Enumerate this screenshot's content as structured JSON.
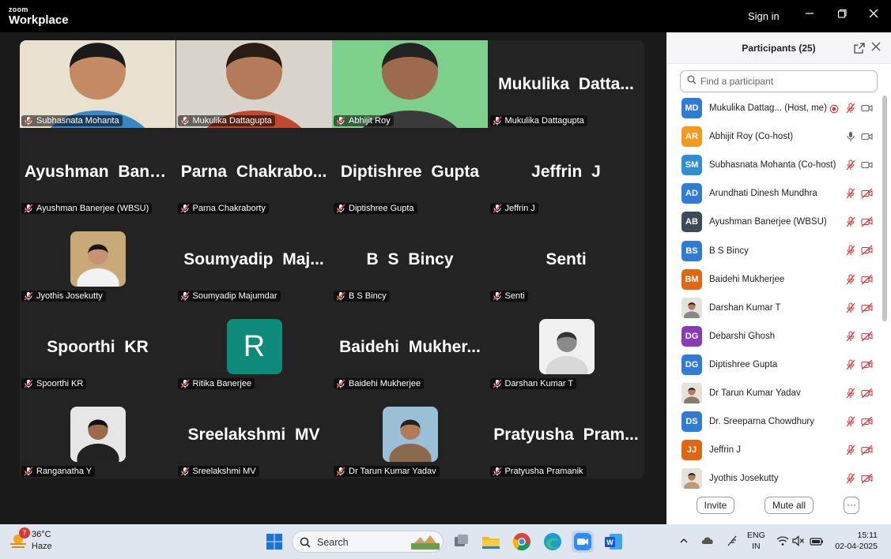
{
  "window": {
    "brand_top": "zoom",
    "brand_main": "Workplace",
    "sign_in": "Sign in",
    "controls": [
      "minimize-icon",
      "maximize-icon",
      "close-icon"
    ]
  },
  "gallery": {
    "tiles": [
      {
        "label": "Subhasnata Mohanta",
        "kind": "video"
      },
      {
        "label": "Mukulika Dattagupta",
        "kind": "video"
      },
      {
        "label": "Abhijit Roy",
        "kind": "video",
        "active": true
      },
      {
        "label": "Mukulika Dattagupta",
        "display": "Mukulika Datta...",
        "kind": "name"
      },
      {
        "label": "Ayushman Banerjee (WBSU)",
        "display": "Ayushman Bane...",
        "kind": "name"
      },
      {
        "label": "Parna Chakraborty",
        "display": "Parna Chakrabo...",
        "kind": "name"
      },
      {
        "label": "Diptishree Gupta",
        "display": "Diptishree Gupta",
        "kind": "name"
      },
      {
        "label": "Jeffrin J",
        "display": "Jeffrin J",
        "kind": "name"
      },
      {
        "label": "Jyothis Josekutty",
        "kind": "photo"
      },
      {
        "label": "Soumyadip Majumdar",
        "display": "Soumyadip Maj...",
        "kind": "name"
      },
      {
        "label": "B S Bincy",
        "display": "B S Bincy",
        "kind": "name"
      },
      {
        "label": "Senti",
        "display": "Senti",
        "kind": "name"
      },
      {
        "label": "Spoorthi KR",
        "display": "Spoorthi KR",
        "kind": "name"
      },
      {
        "label": "Ritika Banerjee",
        "display": "R",
        "kind": "letter"
      },
      {
        "label": "Baidehi Mukherjee",
        "display": "Baidehi Mukher...",
        "kind": "name"
      },
      {
        "label": "Darshan Kumar T",
        "kind": "photo"
      },
      {
        "label": "Ranganatha Y",
        "kind": "photo"
      },
      {
        "label": "Sreelakshmi MV",
        "display": "Sreelakshmi MV",
        "kind": "name"
      },
      {
        "label": "Dr Tarun Kumar Yadav",
        "kind": "photo"
      },
      {
        "label": "Pratyusha Pramanik",
        "display": "Pratyusha Pram...",
        "kind": "name"
      }
    ]
  },
  "participants": {
    "title": "Participants (25)",
    "search_placeholder": "Find a participant",
    "list": [
      {
        "initials": "MD",
        "name": "Mukulika Dattag...  (Host, me)",
        "color": "#2f7bd6",
        "mic": "muted",
        "cam": "on",
        "rec": true
      },
      {
        "initials": "AR",
        "name": "Abhijit Roy (Co-host)",
        "color": "#f39a1e",
        "mic": "on",
        "cam": "on"
      },
      {
        "initials": "SM",
        "name": "Subhasnata Mohanta (Co-host)",
        "color": "#2f8fcf",
        "mic": "muted",
        "cam": "on"
      },
      {
        "initials": "AD",
        "name": "Arundhati Dinesh Mundhra",
        "color": "#2f7bd6",
        "mic": "muted",
        "cam": "off"
      },
      {
        "initials": "AB",
        "name": "Ayushman Banerjee (WBSU)",
        "color": "#3d4a5c",
        "mic": "muted",
        "cam": "off"
      },
      {
        "initials": "BS",
        "name": "B S Bincy",
        "color": "#2f7bd6",
        "mic": "muted",
        "cam": "off"
      },
      {
        "initials": "BM",
        "name": "Baidehi Mukherjee",
        "color": "#e0670f",
        "mic": "muted",
        "cam": "off"
      },
      {
        "initials": "",
        "name": "Darshan Kumar T",
        "color": "#888888",
        "mic": "muted",
        "cam": "off",
        "photo": true
      },
      {
        "initials": "DG",
        "name": "Debarshi Ghosh",
        "color": "#8a3ab9",
        "mic": "muted",
        "cam": "off"
      },
      {
        "initials": "DG",
        "name": "Diptishree Gupta",
        "color": "#2f7bd6",
        "mic": "muted",
        "cam": "off"
      },
      {
        "initials": "",
        "name": "Dr Tarun Kumar Yadav",
        "color": "#8a7a6a",
        "mic": "muted",
        "cam": "off",
        "photo": true
      },
      {
        "initials": "DS",
        "name": "Dr. Sreeparna Chowdhury",
        "color": "#2f7bd6",
        "mic": "muted",
        "cam": "off"
      },
      {
        "initials": "JJ",
        "name": "Jeffrin J",
        "color": "#e0670f",
        "mic": "muted",
        "cam": "off"
      },
      {
        "initials": "",
        "name": "Jyothis Josekutty",
        "color": "#b79b7a",
        "mic": "muted",
        "cam": "off",
        "photo": true
      }
    ],
    "invite": "Invite",
    "mute_all": "Mute all",
    "more": "···"
  },
  "taskbar": {
    "badge": "7",
    "temp": "36°C",
    "condition": "Haze",
    "search": "Search",
    "lang_top": "ENG",
    "lang_bottom": "IN",
    "time": "15:11",
    "date": "02-04-2025"
  },
  "colors": {
    "active_border": "#38d08a",
    "muted_red": "#d93838"
  }
}
